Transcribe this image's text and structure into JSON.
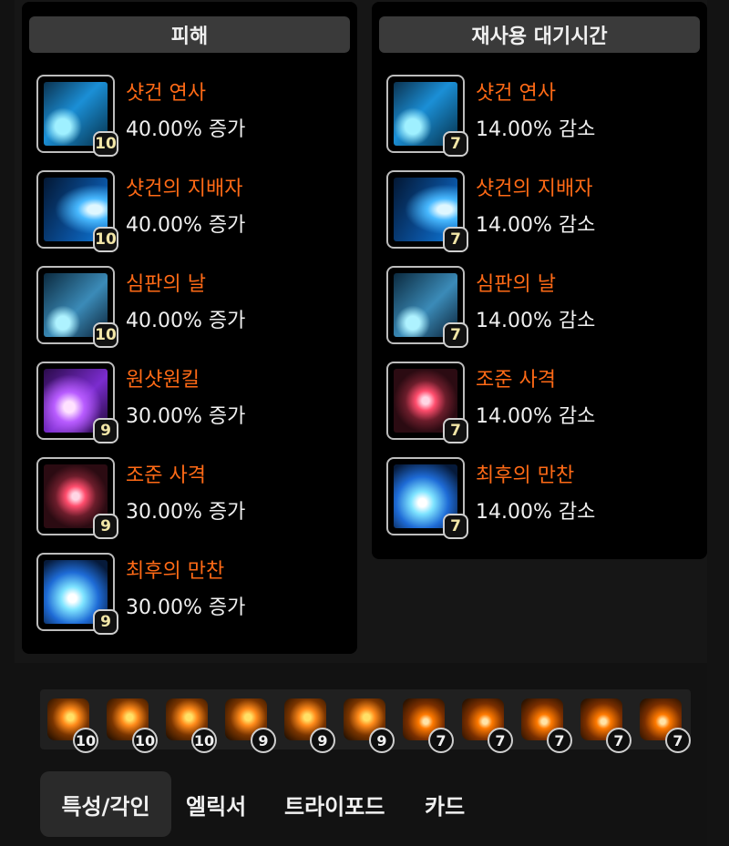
{
  "damage_panel": {
    "title": "피해",
    "skills": [
      {
        "name": "샷건 연사",
        "value": "40.00% 증가",
        "level": "10",
        "icon": "shotgun-barrage-icon"
      },
      {
        "name": "샷건의 지배자",
        "value": "40.00% 증가",
        "level": "10",
        "icon": "shotgun-master-icon"
      },
      {
        "name": "심판의 날",
        "value": "40.00% 증가",
        "level": "10",
        "icon": "judgement-day-icon"
      },
      {
        "name": "원샷원킬",
        "value": "30.00% 증가",
        "level": "9",
        "icon": "one-shot-one-kill-icon"
      },
      {
        "name": "조준 사격",
        "value": "30.00% 증가",
        "level": "9",
        "icon": "aimed-shot-icon"
      },
      {
        "name": "최후의 만찬",
        "value": "30.00% 증가",
        "level": "9",
        "icon": "last-supper-icon"
      }
    ]
  },
  "cooldown_panel": {
    "title": "재사용 대기시간",
    "skills": [
      {
        "name": "샷건 연사",
        "value": "14.00% 감소",
        "level": "7",
        "icon": "shotgun-barrage-icon"
      },
      {
        "name": "샷건의 지배자",
        "value": "14.00% 감소",
        "level": "7",
        "icon": "shotgun-master-icon"
      },
      {
        "name": "심판의 날",
        "value": "14.00% 감소",
        "level": "7",
        "icon": "judgement-day-icon"
      },
      {
        "name": "조준 사격",
        "value": "14.00% 감소",
        "level": "7",
        "icon": "aimed-shot-icon"
      },
      {
        "name": "최후의 만찬",
        "value": "14.00% 감소",
        "level": "7",
        "icon": "last-supper-icon"
      }
    ]
  },
  "engravings": [
    {
      "level": "10",
      "icon": "gem-icon"
    },
    {
      "level": "10",
      "icon": "gem-icon"
    },
    {
      "level": "10",
      "icon": "gem-icon"
    },
    {
      "level": "9",
      "icon": "gem-icon"
    },
    {
      "level": "9",
      "icon": "gem-icon"
    },
    {
      "level": "9",
      "icon": "gem-icon"
    },
    {
      "level": "7",
      "icon": "gem-icon"
    },
    {
      "level": "7",
      "icon": "gem-icon"
    },
    {
      "level": "7",
      "icon": "gem-icon"
    },
    {
      "level": "7",
      "icon": "gem-icon"
    },
    {
      "level": "7",
      "icon": "gem-icon"
    }
  ],
  "tabs": [
    {
      "label": "특성/각인",
      "active": true
    },
    {
      "label": "엘릭서",
      "active": false
    },
    {
      "label": "트라이포드",
      "active": false
    },
    {
      "label": "카드",
      "active": false
    }
  ],
  "colors": {
    "skill_name": "#ff6a16",
    "panel_bg": "#000000",
    "header_bg": "#3a3a3a",
    "text": "#f0f0f0"
  }
}
